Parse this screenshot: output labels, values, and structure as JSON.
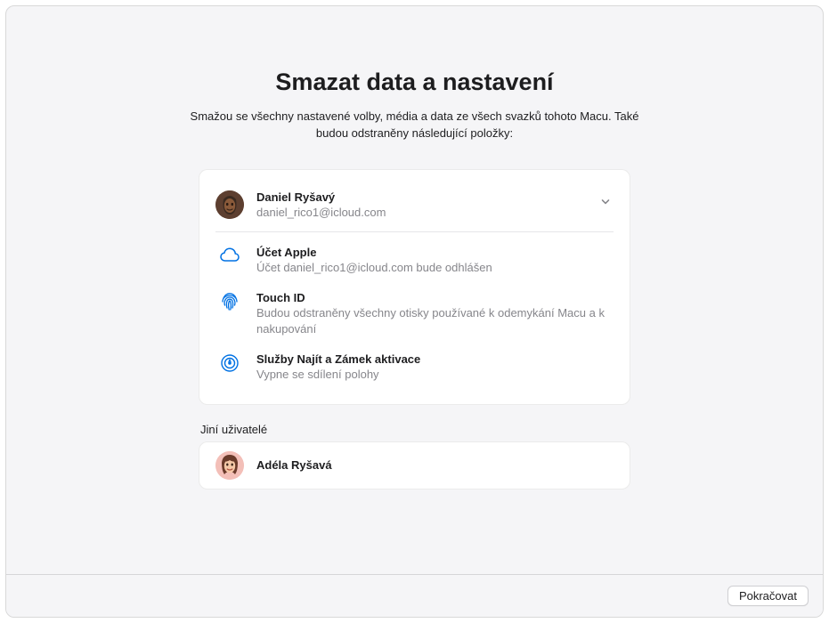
{
  "page": {
    "title": "Smazat data a nastavení",
    "subtitle": "Smažou se všechny nastavené volby, média a data ze všech svazků tohoto Macu. Také budou odstraněny následující položky:"
  },
  "primaryUser": {
    "name": "Daniel Ryšavý",
    "email": "daniel_rico1@icloud.com"
  },
  "items": {
    "appleAccount": {
      "title": "Účet Apple",
      "sub": "Účet daniel_rico1@icloud.com bude odhlášen"
    },
    "touchId": {
      "title": "Touch ID",
      "sub": "Budou odstraněny všechny otisky používané k odemykání Macu a k nakupování"
    },
    "findMy": {
      "title": "Služby Najít a Zámek aktivace",
      "sub": "Vypne se sdílení polohy"
    }
  },
  "otherUsers": {
    "label": "Jiní uživatelé",
    "user": {
      "name": "Adéla Ryšavá"
    }
  },
  "footer": {
    "continue": "Pokračovat"
  }
}
